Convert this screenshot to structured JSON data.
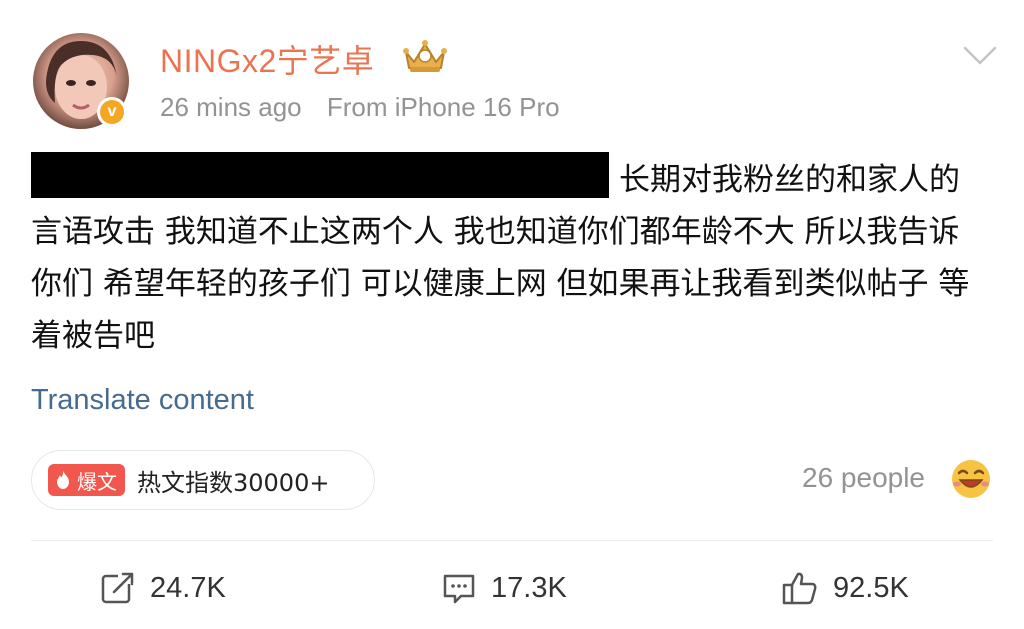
{
  "post": {
    "username": "NINGx2宁艺卓",
    "time_ago": "26 mins ago",
    "source": "From iPhone 16 Pro",
    "content_text": "长期对我粉丝的和家人的言语攻击 我知道不止这两个人 我也知道你们都年龄不大 所以我告诉你们 希望年轻的孩子们 可以健康上网 但如果再让我看到类似帖子 等着被告吧",
    "translate_label": "Translate content",
    "hot_tag_label": "爆文",
    "hot_index_text": "热文指数30000+",
    "reactions_text": "26 people",
    "verified_mark": "v"
  },
  "actions": {
    "repost_count": "24.7K",
    "comment_count": "17.3K",
    "like_count": "92.5K"
  },
  "colors": {
    "username": "#eb7350",
    "meta": "#939393",
    "link": "#456b8e",
    "hot_tag": "#f2574e",
    "verified": "#f5a623"
  },
  "icons": {
    "avatar": "avatar",
    "verified": "verified-badge-icon",
    "crown": "crown-icon",
    "chevron": "chevron-down-icon",
    "fire": "fire-icon",
    "emoji": "laughing-emoji-icon",
    "repost": "repost-icon",
    "comment": "comment-icon",
    "like": "thumbs-up-icon"
  }
}
